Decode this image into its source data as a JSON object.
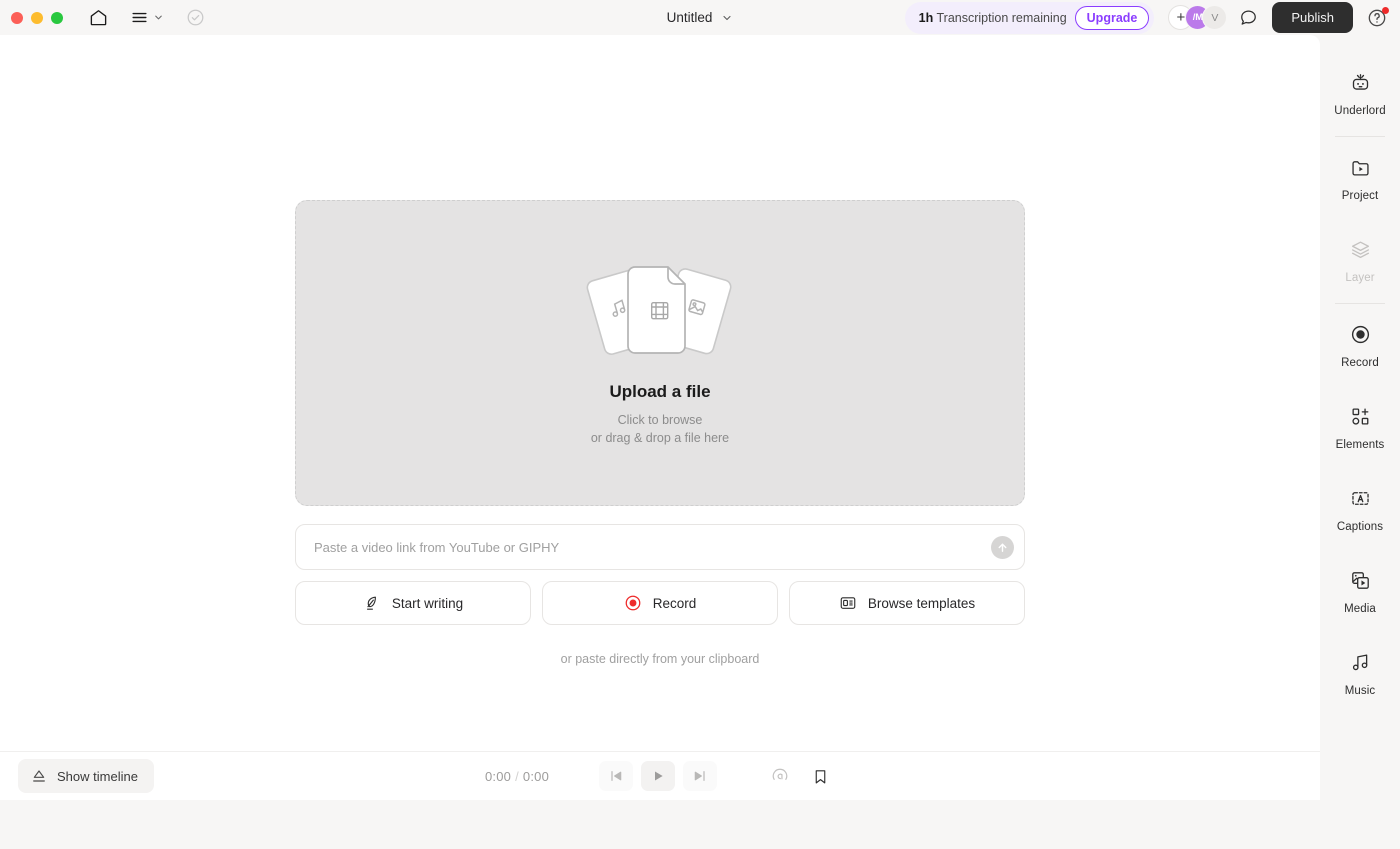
{
  "topbar": {
    "window_controls": [
      "close",
      "minimize",
      "zoom"
    ],
    "home_icon": "home-icon",
    "menu_icon": "hamburger-menu-icon",
    "menu_chevron": "chevron-down-icon",
    "saved_icon": "check-circle-icon",
    "document_title": "Untitled",
    "title_chevron": "chevron-down-icon",
    "transcription": {
      "amount": "1h",
      "label": "Transcription remaining"
    },
    "upgrade_label": "Upgrade",
    "avatars": {
      "add_label": "+",
      "user_initials": "/M",
      "more_label": "V"
    },
    "comment_icon": "comment-icon",
    "publish_label": "Publish",
    "help_icon": "help-circle-icon",
    "accent_purple": "#8b3dff",
    "publish_bg": "#2e2e2e"
  },
  "upload": {
    "title": "Upload a file",
    "line1": "Click to browse",
    "line2": "or drag & drop a file here",
    "card_icons": [
      "music-note-icon",
      "film-strip-icon",
      "image-icon"
    ]
  },
  "link": {
    "placeholder": "Paste a video link from YouTube or GIPHY",
    "value": "",
    "submit_icon": "arrow-up-circle-icon"
  },
  "actions": [
    {
      "label": "Start writing",
      "icon": "pen-feather-icon"
    },
    {
      "label": "Record",
      "icon": "record-dot-icon"
    },
    {
      "label": "Browse templates",
      "icon": "templates-icon"
    }
  ],
  "clipboard_note": "or paste directly from your clipboard",
  "sidebar": {
    "items": [
      {
        "label": "Underlord",
        "icon": "robot-icon",
        "disabled": false
      },
      {
        "label": "Project",
        "icon": "folder-play-icon",
        "disabled": false
      },
      {
        "label": "Layer",
        "icon": "layers-icon",
        "disabled": true
      },
      {
        "label": "Record",
        "icon": "record-dot-icon",
        "disabled": false
      },
      {
        "label": "Elements",
        "icon": "elements-add-icon",
        "disabled": false
      },
      {
        "label": "Captions",
        "icon": "captions-icon",
        "disabled": false
      },
      {
        "label": "Media",
        "icon": "media-stack-icon",
        "disabled": false
      },
      {
        "label": "Music",
        "icon": "music-note-icon",
        "disabled": false
      }
    ]
  },
  "bottombar": {
    "timeline_label": "Show timeline",
    "timeline_icon": "panel-up-icon",
    "current_time": "0:00",
    "separator": "/",
    "total_time": "0:00",
    "skip_back_icon": "skip-back-icon",
    "play_icon": "play-icon",
    "skip_forward_icon": "skip-forward-icon",
    "speed_icon": "speed-gauge-icon",
    "bookmark_icon": "bookmark-icon"
  }
}
